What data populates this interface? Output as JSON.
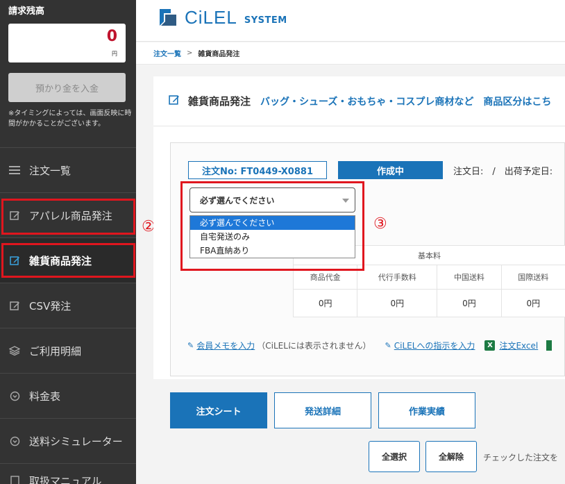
{
  "sidebar": {
    "balance_title": "請求残高",
    "balance_amount": "0",
    "balance_unit": "円",
    "deposit_button": "預かり金を入金",
    "notice": "※タイミングによっては、画面反映に時間がかかることがございます。",
    "items": [
      {
        "label": "注文一覧",
        "icon": "list-icon"
      },
      {
        "label": "アパレル商品発注",
        "icon": "edit-icon"
      },
      {
        "label": "雑貨商品発注",
        "icon": "edit-icon"
      },
      {
        "label": "CSV発注",
        "icon": "edit-icon"
      },
      {
        "label": "ご利用明細",
        "icon": "layers-icon"
      },
      {
        "label": "料金表",
        "icon": "circle-chevron-icon"
      },
      {
        "label": "送料シミュレーター",
        "icon": "circle-chevron-icon"
      },
      {
        "label": "取扱マニュアル",
        "icon": "book-icon"
      }
    ]
  },
  "annotations": {
    "two": "②",
    "three": "③",
    "color": "#e0161e"
  },
  "header": {
    "logo_text": "CiLEL",
    "logo_sub": "SYSTEM"
  },
  "breadcrumb": {
    "link": "注文一覧",
    "separator": ">",
    "current": "雑貨商品発注"
  },
  "card": {
    "title": "雑貨商品発注",
    "subtitle": "バッグ・シューズ・おもちゃ・コスプレ商材など",
    "subtitle_link": "商品区分はこち"
  },
  "order": {
    "number": "注文No: FT0449-X0881",
    "status": "作成中",
    "dates": "注文日:　/　出荷予定日:"
  },
  "shipping_select": {
    "selected": "必ず選んでください",
    "options": [
      "必ず選んでください",
      "自宅発送のみ",
      "FBA直納あり"
    ]
  },
  "fee_table": {
    "group_header": "基本料",
    "columns": [
      "商品代金",
      "代行手数料",
      "中国送料",
      "国際送料"
    ],
    "values": [
      "0円",
      "0円",
      "0円",
      "0円"
    ]
  },
  "links": {
    "member_memo": "会員メモを入力",
    "member_memo_note": "（CiLELには表示されません）",
    "instruction": "CiLELへの指示を入力",
    "excel": "注文Excel",
    "excel_icon": "X"
  },
  "tabs": [
    "注文シート",
    "発送詳細",
    "作業実績"
  ],
  "actions": {
    "select_all": "全選択",
    "deselect_all": "全解除",
    "check_text": "チェックした注文を"
  },
  "colors": {
    "brand": "#1a73b8",
    "sidebar": "#333333",
    "highlight": "#e0161e"
  }
}
